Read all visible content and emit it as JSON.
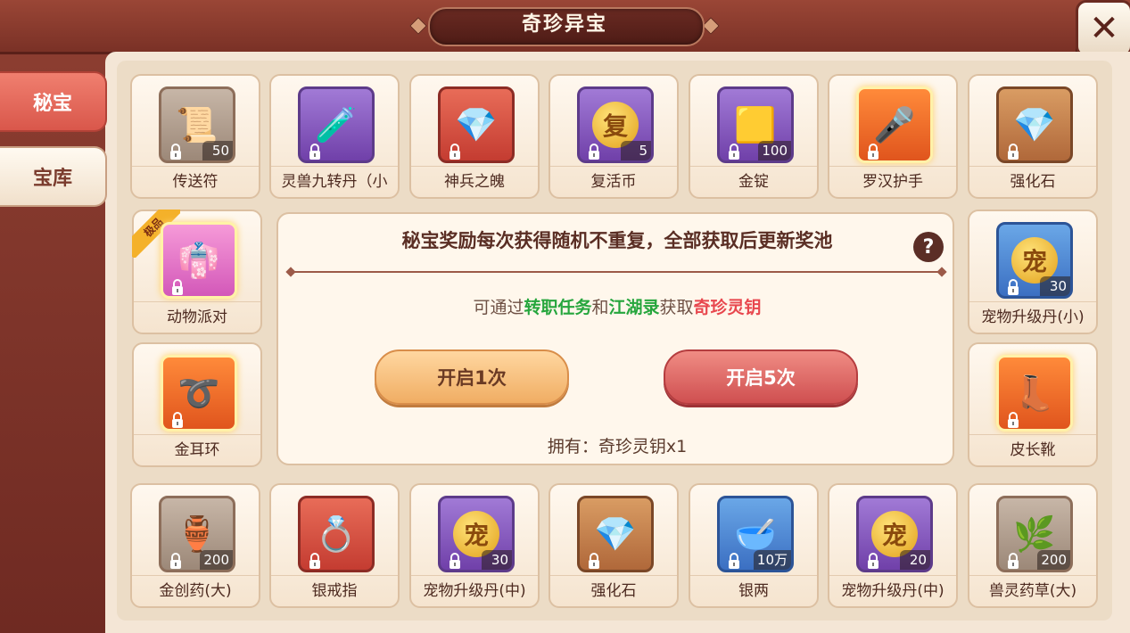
{
  "window": {
    "title": "奇珍异宝",
    "close_icon": "close-icon"
  },
  "tabs": [
    {
      "label": "秘宝",
      "active": true
    },
    {
      "label": "宝库",
      "active": false
    }
  ],
  "items_top": [
    {
      "name": "传送符",
      "count": "50",
      "quality": "gray",
      "icon": "teleport-talisman-icon"
    },
    {
      "name": "灵兽九转丹（小",
      "count": "",
      "quality": "purple",
      "icon": "pet-pill-icon"
    },
    {
      "name": "神兵之魄",
      "count": "",
      "quality": "red",
      "icon": "crystal-icon"
    },
    {
      "name": "复活币",
      "count": "5",
      "quality": "purple",
      "icon": "revive-coin-icon"
    },
    {
      "name": "金锭",
      "count": "100",
      "quality": "purple",
      "icon": "gold-ingot-icon"
    },
    {
      "name": "罗汉护手",
      "count": "",
      "quality": "orange",
      "icon": "gauntlet-icon"
    },
    {
      "name": "强化石",
      "count": "",
      "quality": "brown",
      "icon": "enhance-stone-icon"
    }
  ],
  "items_left": [
    {
      "name": "动物派对",
      "count": "",
      "quality": "pink",
      "icon": "costume-icon",
      "badge": "极品"
    },
    {
      "name": "金耳环",
      "count": "",
      "quality": "orange",
      "icon": "earring-icon"
    }
  ],
  "items_right": [
    {
      "name": "宠物升级丹(小)",
      "count": "30",
      "quality": "blue",
      "icon": "pet-upgrade-pill-icon",
      "coin_char": "宠"
    },
    {
      "name": "皮长靴",
      "count": "",
      "quality": "orange",
      "icon": "boots-icon"
    }
  ],
  "items_bottom": [
    {
      "name": "金创药(大)",
      "count": "200",
      "quality": "gray",
      "icon": "medicine-bottle-icon"
    },
    {
      "name": "银戒指",
      "count": "",
      "quality": "red",
      "icon": "silver-ring-icon"
    },
    {
      "name": "宠物升级丹(中)",
      "count": "30",
      "quality": "purple",
      "icon": "pet-upgrade-pill-icon",
      "coin_char": "宠"
    },
    {
      "name": "强化石",
      "count": "",
      "quality": "brown",
      "icon": "enhance-stone-icon"
    },
    {
      "name": "银两",
      "count": "10万",
      "quality": "blue",
      "icon": "silver-ingot-icon"
    },
    {
      "name": "宠物升级丹(中)",
      "count": "20",
      "quality": "purple",
      "icon": "pet-upgrade-pill-icon",
      "coin_char": "宠"
    },
    {
      "name": "兽灵药草(大)",
      "count": "200",
      "quality": "gray",
      "icon": "herb-icon"
    }
  ],
  "center": {
    "title": "秘宝奖励每次获得随机不重复，全部获取后更新奖池",
    "source_prefix": "可通过",
    "source_task": "转职任务",
    "source_and": "和",
    "source_book": "江湖录",
    "source_get": "获取",
    "source_key": "奇珍灵钥",
    "open_once": "开启1次",
    "open_five": "开启5次",
    "owned": "拥有：奇珍灵钥x1"
  },
  "colors": {
    "accent_red": "#d9574b",
    "highlight_green": "#26a63d",
    "highlight_red": "#e8474e",
    "frame": "#8e3f32"
  }
}
